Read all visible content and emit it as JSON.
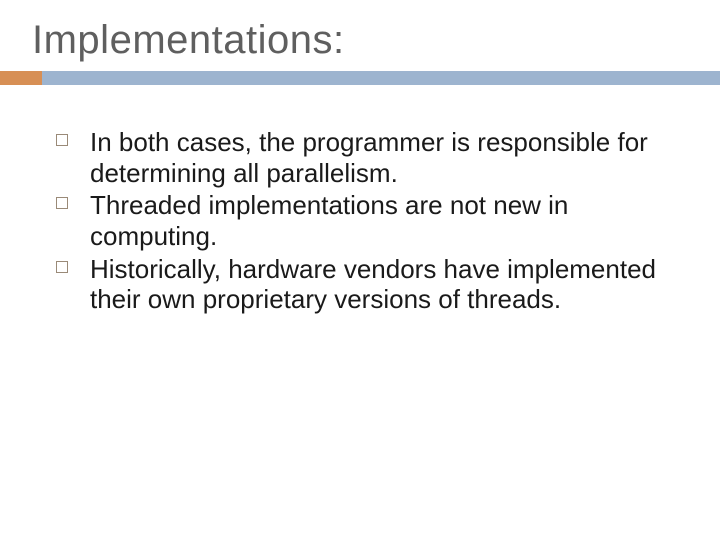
{
  "title": "Implementations:",
  "bullets": [
    "In both cases, the programmer is responsible for determining all parallelism.",
    "Threaded implementations are not new in computing.",
    "Historically, hardware vendors have implemented their own proprietary versions of threads."
  ],
  "colors": {
    "rule_blue": "#9db4cf",
    "rule_orange": "#d78f55",
    "title_color": "#5f5f5f"
  }
}
